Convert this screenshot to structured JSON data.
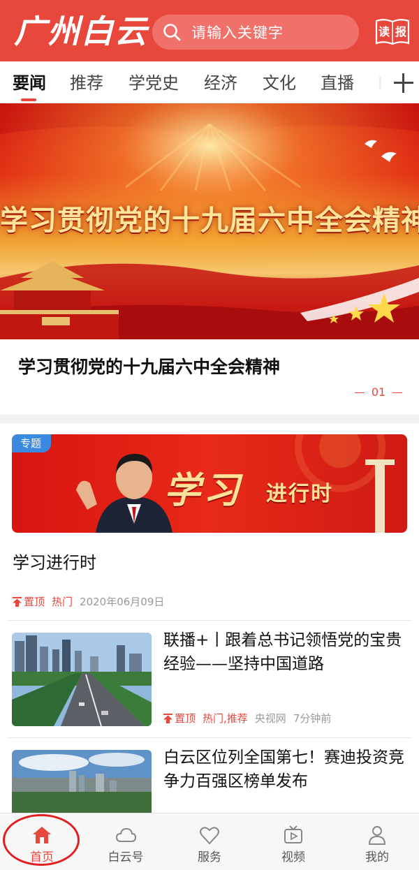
{
  "header": {
    "logo_text": "广州白云",
    "search_placeholder": "请输入关键字",
    "dubao_label_left": "读",
    "dubao_label_right": "报"
  },
  "tabs": [
    {
      "label": "要闻",
      "active": true
    },
    {
      "label": "推荐",
      "active": false
    },
    {
      "label": "学党史",
      "active": false
    },
    {
      "label": "经济",
      "active": false
    },
    {
      "label": "文化",
      "active": false
    },
    {
      "label": "直播",
      "active": false
    },
    {
      "label": "E",
      "active": false
    }
  ],
  "banner": {
    "image_text": "学习贯彻党的十九届六中全会精神",
    "headline": "学习贯彻党的十九届六中全会精神",
    "pager": "01"
  },
  "special_card": {
    "tag": "专题",
    "image_title": "学习",
    "image_subtitle": "进行时",
    "title": "学习进行时",
    "pin": "置顶",
    "hot": "热门",
    "date": "2020年06月09日"
  },
  "news": [
    {
      "title": "联播+丨跟着总书记领悟党的宝贵经验——坚持中国道路",
      "pin": "置顶",
      "tags": "热门,推荐",
      "source": "央视网",
      "time": "7分钟前"
    },
    {
      "title": "白云区位列全国第七！赛迪投资竞争力百强区榜单发布"
    }
  ],
  "bottom_nav": [
    {
      "label": "首页",
      "icon": "home-icon",
      "active": true
    },
    {
      "label": "白云号",
      "icon": "cloud-icon",
      "active": false
    },
    {
      "label": "服务",
      "icon": "heart-icon",
      "active": false
    },
    {
      "label": "视频",
      "icon": "video-icon",
      "active": false
    },
    {
      "label": "我的",
      "icon": "user-icon",
      "active": false
    }
  ],
  "colors": {
    "brand_red": "#e8473c",
    "tag_blue": "#3a8ae0",
    "annotation_circle": "#e02020"
  }
}
